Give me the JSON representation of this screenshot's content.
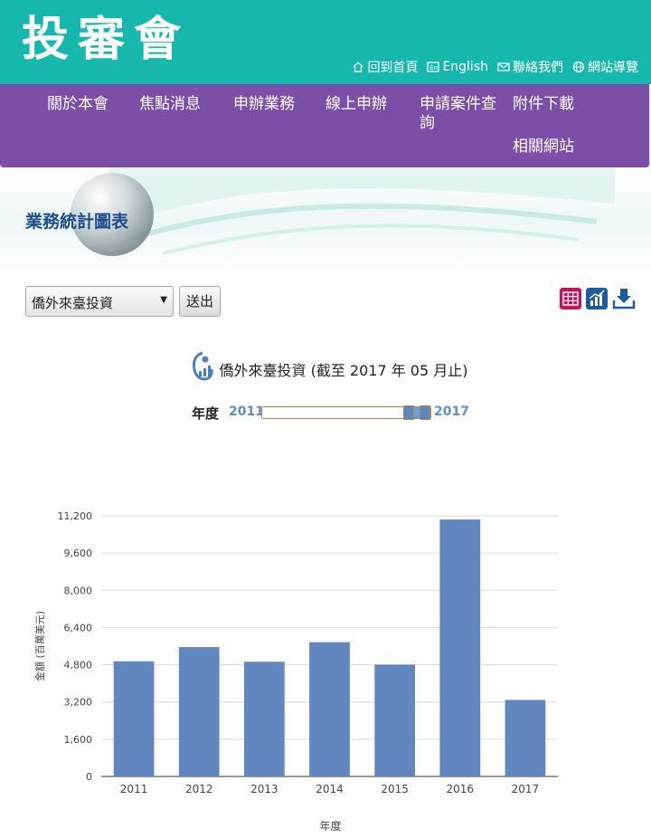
{
  "header": {
    "logo_text": "投審會",
    "links": [
      {
        "label": "回到首頁",
        "icon": "home-icon"
      },
      {
        "label": "English",
        "icon": "english-icon"
      },
      {
        "label": "聯絡我們",
        "icon": "mail-icon"
      },
      {
        "label": "網站導覽",
        "icon": "globe-icon"
      }
    ]
  },
  "nav": {
    "items": [
      {
        "label": "關於本會"
      },
      {
        "label": "焦點消息"
      },
      {
        "label": "申辦業務"
      },
      {
        "label": "線上申辦"
      },
      {
        "label": "申請案件查詢"
      },
      {
        "label": "附件下載"
      },
      {
        "label": "相關網站"
      }
    ]
  },
  "page": {
    "title": "業務統計圖表",
    "select_value": "僑外來臺投資",
    "send_label": "送出",
    "tools": [
      "table-view-icon",
      "chart-view-icon",
      "download-icon"
    ]
  },
  "chart_header": {
    "title": "僑外來臺投資 (截至 2017 年 05 月止)",
    "year_label": "年度",
    "range_start": "2011",
    "range_end": "2017"
  },
  "chart_data": {
    "type": "bar",
    "categories": [
      "2011",
      "2012",
      "2013",
      "2014",
      "2015",
      "2016",
      "2017"
    ],
    "values": [
      4950,
      5560,
      4930,
      5770,
      4800,
      11040,
      3290
    ],
    "xlabel": "年度",
    "ylabel": "金額 (百萬美元)",
    "ylim": [
      0,
      11200
    ],
    "yticks": [
      "0",
      "1,600",
      "3,200",
      "4,800",
      "6,400",
      "8,000",
      "9,600",
      "11,200"
    ],
    "grid": true,
    "bar_color": "#6286bf"
  },
  "colors": {
    "header": "#16b8ad",
    "nav": "#7b4ea8",
    "title": "#1f4e8c"
  }
}
